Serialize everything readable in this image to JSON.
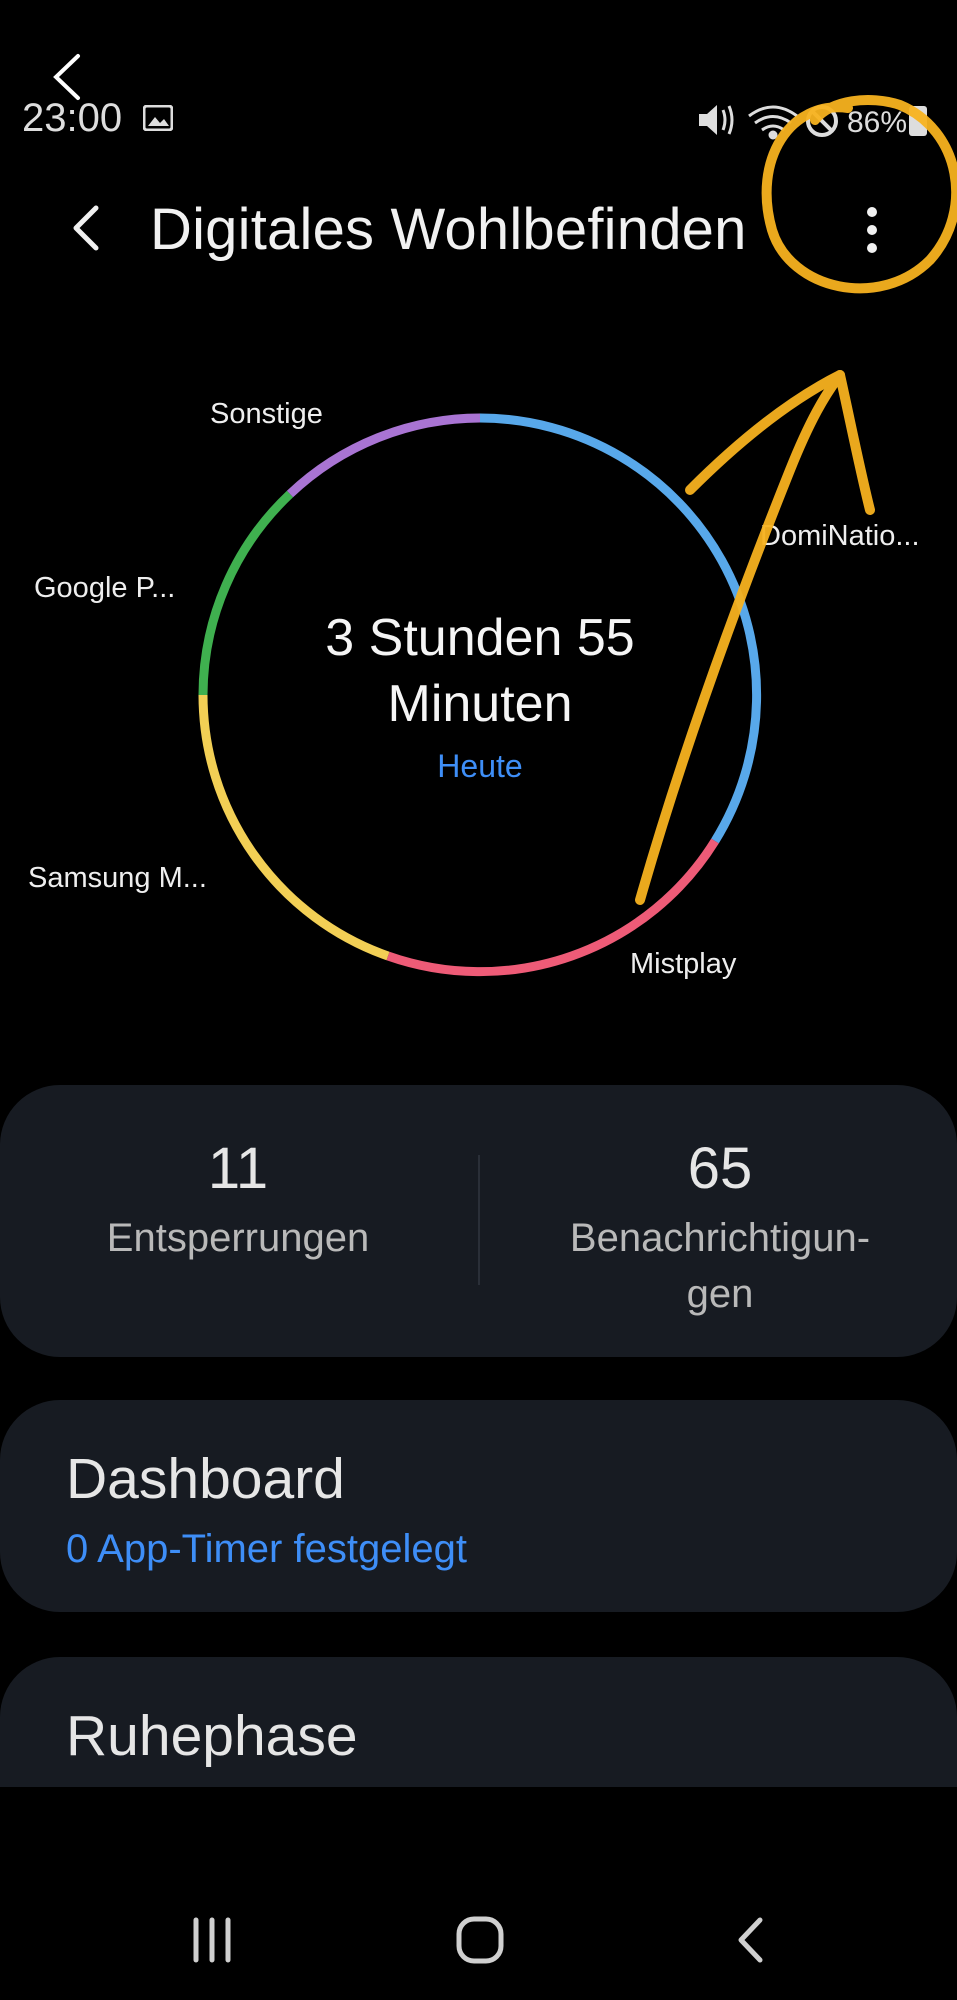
{
  "status_bar": {
    "time": "23:00",
    "icons": [
      "image-icon",
      "mute-icon",
      "wifi-icon",
      "block-icon",
      "battery-icon"
    ]
  },
  "header": {
    "title": "Digitales Wohlbefinden"
  },
  "usage": {
    "total_line1": "3 Stunden 55",
    "total_line2": "Minuten",
    "period": "Heute",
    "apps": [
      {
        "name": "Sonstige",
        "color": "#a974d3"
      },
      {
        "name": "DomiNatio...",
        "color": "#58a8ea"
      },
      {
        "name": "Mistplay",
        "color": "#ee5b77"
      },
      {
        "name": "Samsung M...",
        "color": "#f2cf55"
      },
      {
        "name": "Google P...",
        "color": "#3fb04f"
      }
    ]
  },
  "stats": {
    "unlocks_value": "11",
    "unlocks_label": "Entsperrungen",
    "notifications_value": "65",
    "notifications_label_line1": "Benachrichtigun-",
    "notifications_label_line2": "gen"
  },
  "dashboard": {
    "title": "Dashboard",
    "subtitle": "0 App-Timer festgelegt"
  },
  "rest_phase": {
    "title": "Ruhephase"
  },
  "annotation_color": "#f7b21f",
  "accent_color": "#3e8ef7"
}
